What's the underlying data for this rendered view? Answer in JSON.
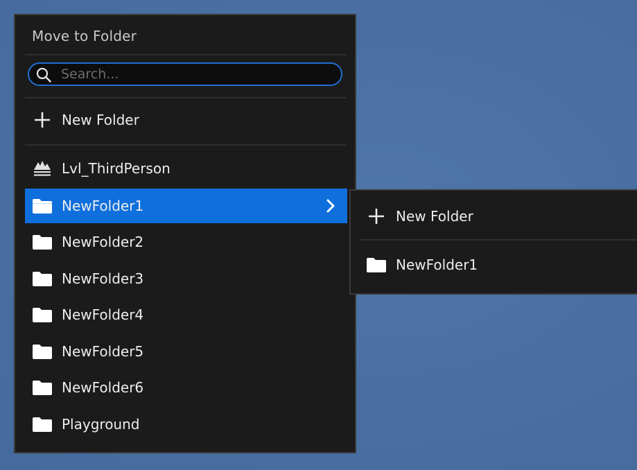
{
  "menu": {
    "title": "Move to Folder",
    "search": {
      "placeholder": "Search...",
      "value": ""
    },
    "new_folder_label": "New Folder",
    "items": [
      {
        "label": "Lvl_ThirdPerson",
        "icon": "level-icon",
        "selected": false
      },
      {
        "label": "NewFolder1",
        "icon": "folder-icon",
        "selected": true,
        "has_submenu": true
      },
      {
        "label": "NewFolder2",
        "icon": "folder-icon",
        "selected": false
      },
      {
        "label": "NewFolder3",
        "icon": "folder-icon",
        "selected": false
      },
      {
        "label": "NewFolder4",
        "icon": "folder-icon",
        "selected": false
      },
      {
        "label": "NewFolder5",
        "icon": "folder-icon",
        "selected": false
      },
      {
        "label": "NewFolder6",
        "icon": "folder-icon",
        "selected": false
      },
      {
        "label": "Playground",
        "icon": "folder-icon",
        "selected": false
      }
    ]
  },
  "submenu": {
    "new_folder_label": "New Folder",
    "items": [
      {
        "label": "NewFolder1",
        "icon": "folder-icon"
      }
    ]
  },
  "colors": {
    "background": "#4a6fa2",
    "panel": "#1b1b1b",
    "panel_border": "#3a3a3a",
    "accent": "#0f6fdc",
    "search_border": "#1f6fd6"
  }
}
